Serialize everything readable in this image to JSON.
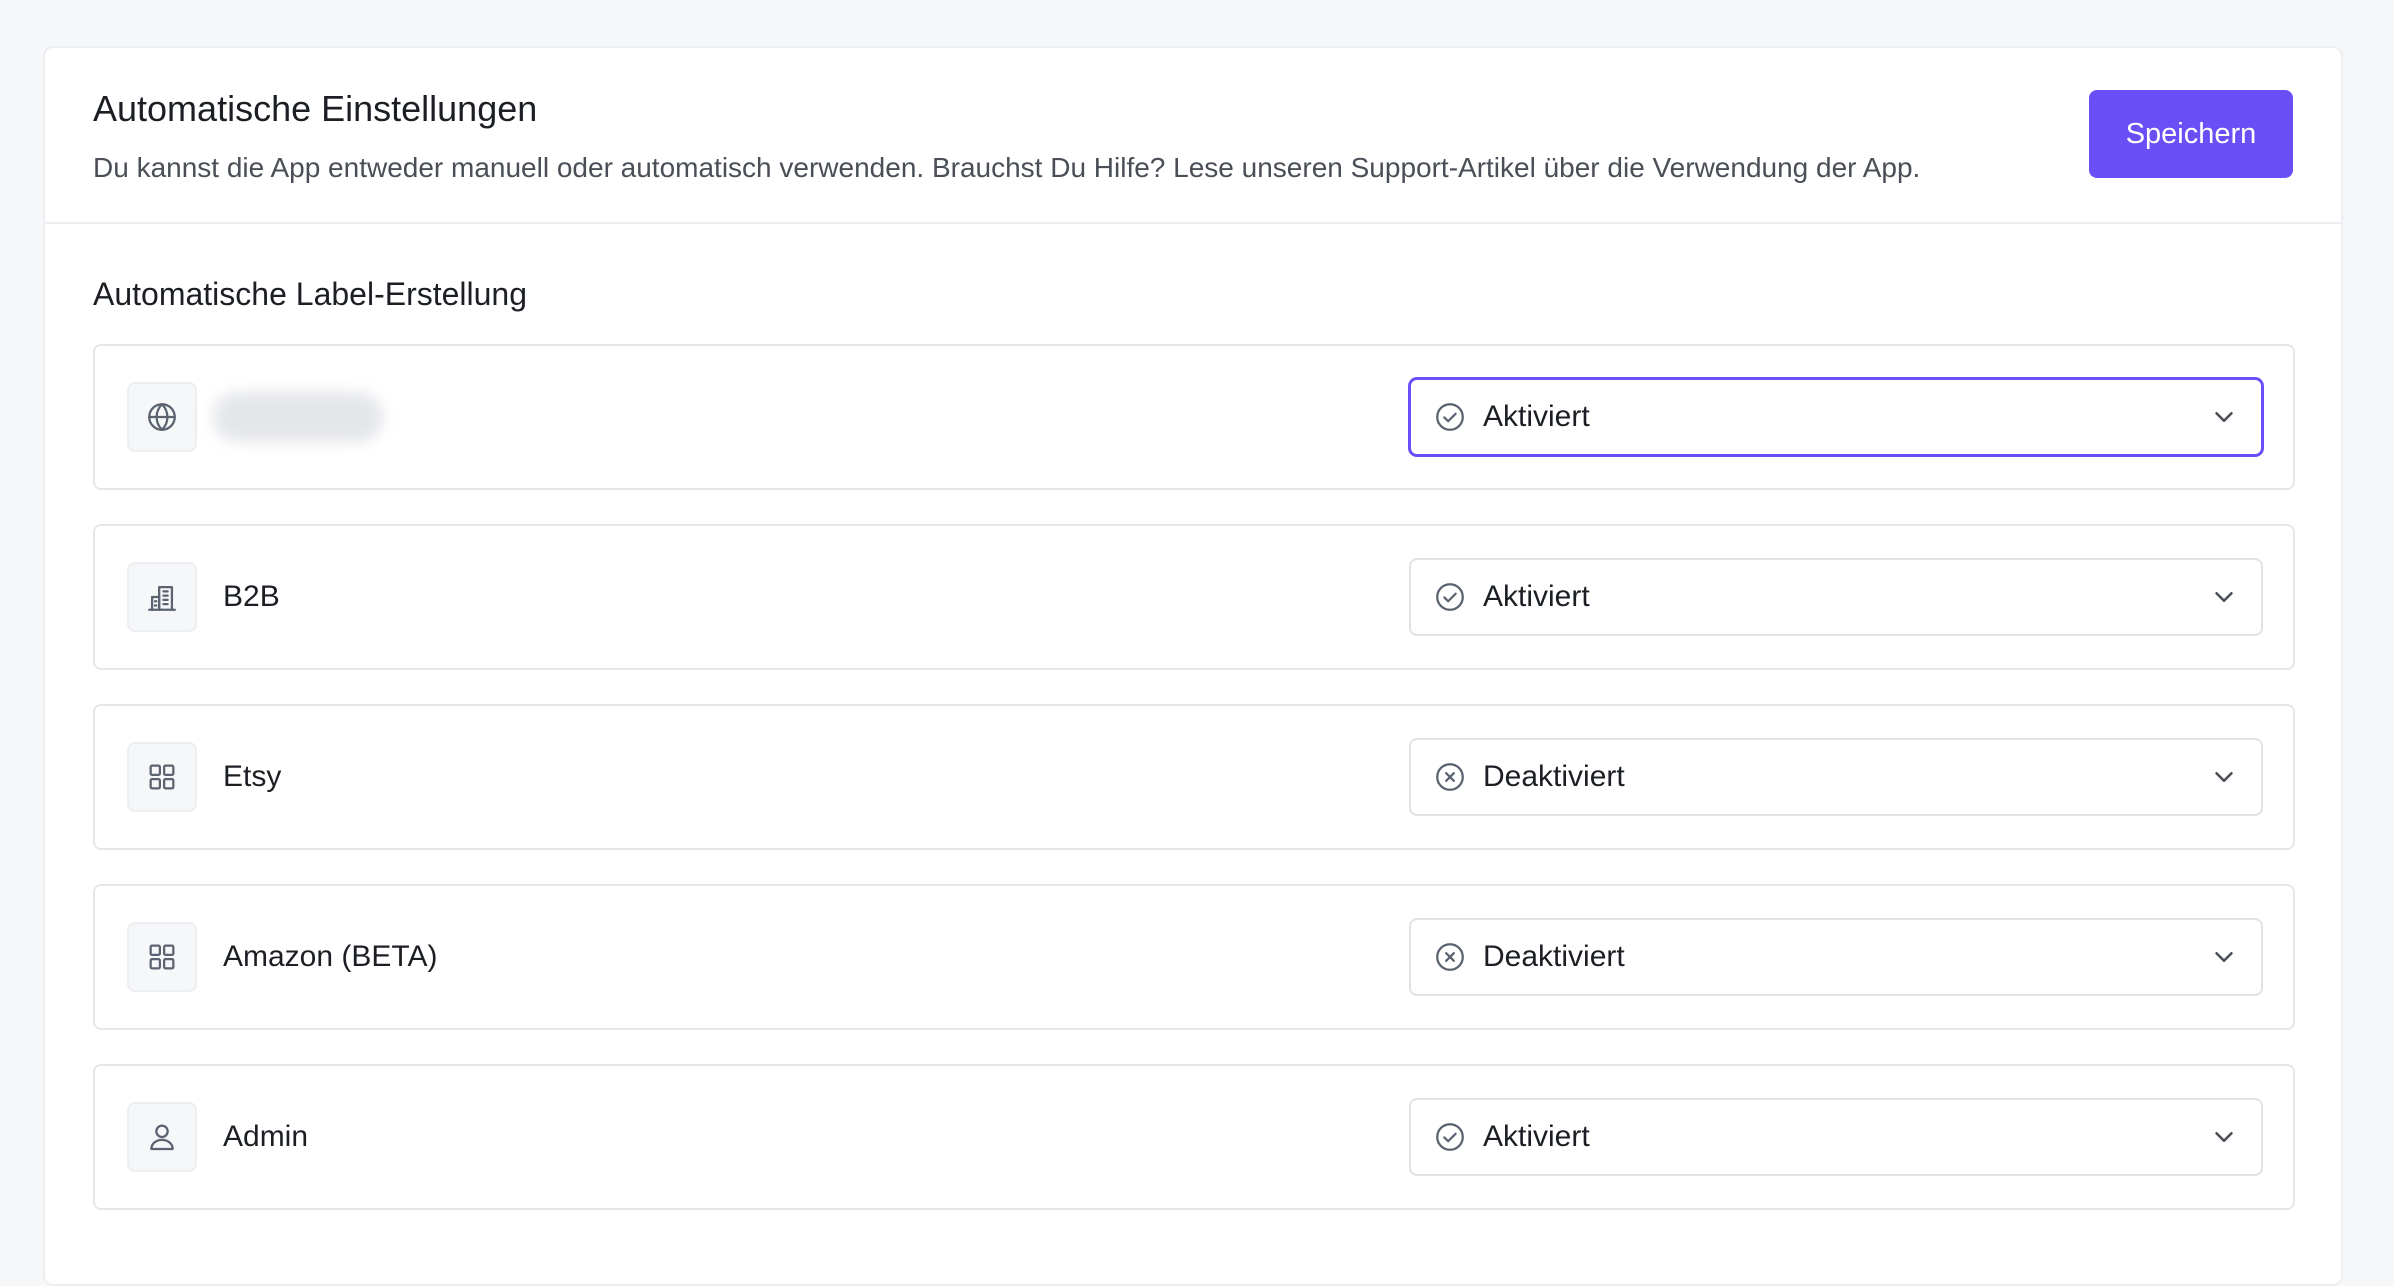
{
  "header": {
    "title": "Automatische Einstellungen",
    "description": "Du kannst die App entweder manuell oder automatisch verwenden. Brauchst Du Hilfe? Lese unseren Support-Artikel über die Verwendung der App.",
    "save_label": "Speichern"
  },
  "section": {
    "title": "Automatische Label-Erstellung"
  },
  "rows": [
    {
      "label": "",
      "icon": "globe-icon",
      "value": "Aktiviert",
      "status": "enabled"
    },
    {
      "label": "B2B",
      "icon": "building-icon",
      "value": "Aktiviert",
      "status": "enabled"
    },
    {
      "label": "Etsy",
      "icon": "grid-icon",
      "value": "Deaktiviert",
      "status": "disabled"
    },
    {
      "label": "Amazon (BETA)",
      "icon": "grid-icon",
      "value": "Deaktiviert",
      "status": "disabled"
    },
    {
      "label": "Admin",
      "icon": "user-icon",
      "value": "Aktiviert",
      "status": "enabled"
    }
  ],
  "colors": {
    "accent": "#6b4ff6",
    "icon": "#5b6270"
  }
}
